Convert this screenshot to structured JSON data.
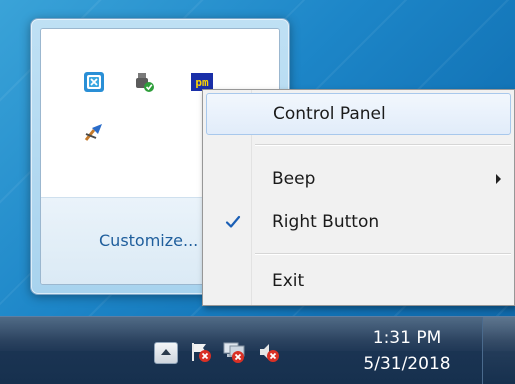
{
  "flyout": {
    "customize_label": "Customize..."
  },
  "tray_icons": [
    {
      "name": "xceed-app-icon"
    },
    {
      "name": "usb-safely-remove-icon"
    },
    {
      "name": "pm-app-icon"
    },
    {
      "name": "network-tool-icon"
    }
  ],
  "context_menu": {
    "items": [
      {
        "label": "Control Panel",
        "highlighted": true
      },
      {
        "label": "Beep",
        "has_submenu": true
      },
      {
        "label": "Right Button",
        "checked": true
      },
      {
        "label": "Exit"
      }
    ]
  },
  "taskbar": {
    "clock_time": "1:31 PM",
    "clock_date": "5/31/2018",
    "icons": [
      "action-center-flag-icon",
      "network-disconnected-icon",
      "volume-muted-icon"
    ]
  },
  "colors": {
    "desktop_blue": "#1d86c8",
    "taskbar": "#16304e",
    "menu_bg": "#f1f1f1",
    "highlight": "#e1ecfa",
    "link": "#1f5e9c",
    "check": "#1b5fb5",
    "error_red": "#d93025"
  }
}
